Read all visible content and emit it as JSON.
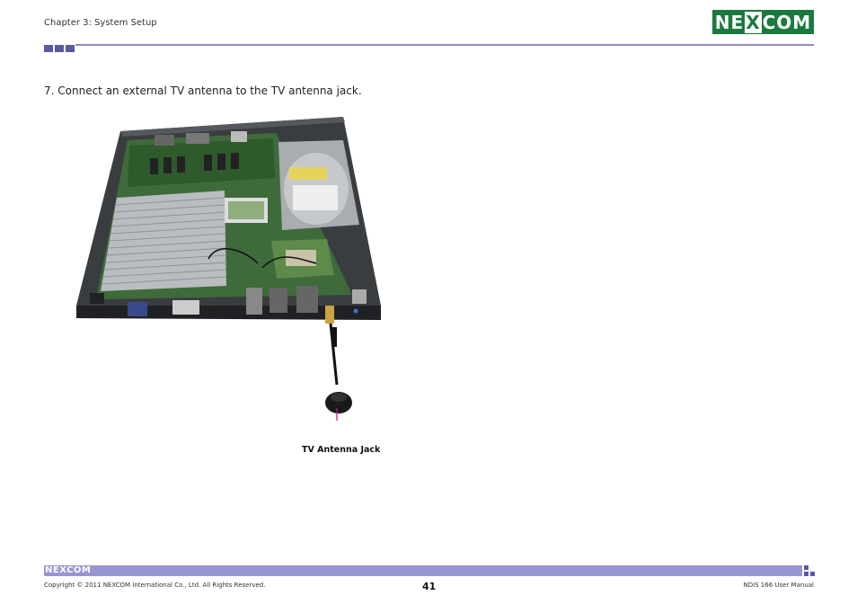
{
  "header": {
    "chapter": "Chapter 3: System Setup",
    "logo_text_left": "NE",
    "logo_text_x": "X",
    "logo_text_right": "COM"
  },
  "content": {
    "step_text": "7. Connect an external TV antenna to the TV antenna jack.",
    "figure_caption": "TV Antenna Jack"
  },
  "footer": {
    "logo_text_left": "NE",
    "logo_text_x": "X",
    "logo_text_right": "COM",
    "copyright": "Copyright © 2011 NEXCOM International Co., Ltd. All Rights Reserved.",
    "page_number": "41",
    "manual_name": "NDiS 166 User Manual"
  },
  "colors": {
    "brand_green": "#1a7a3d",
    "accent_purple": "#5a59a3",
    "callout_magenta": "#c0167e"
  }
}
